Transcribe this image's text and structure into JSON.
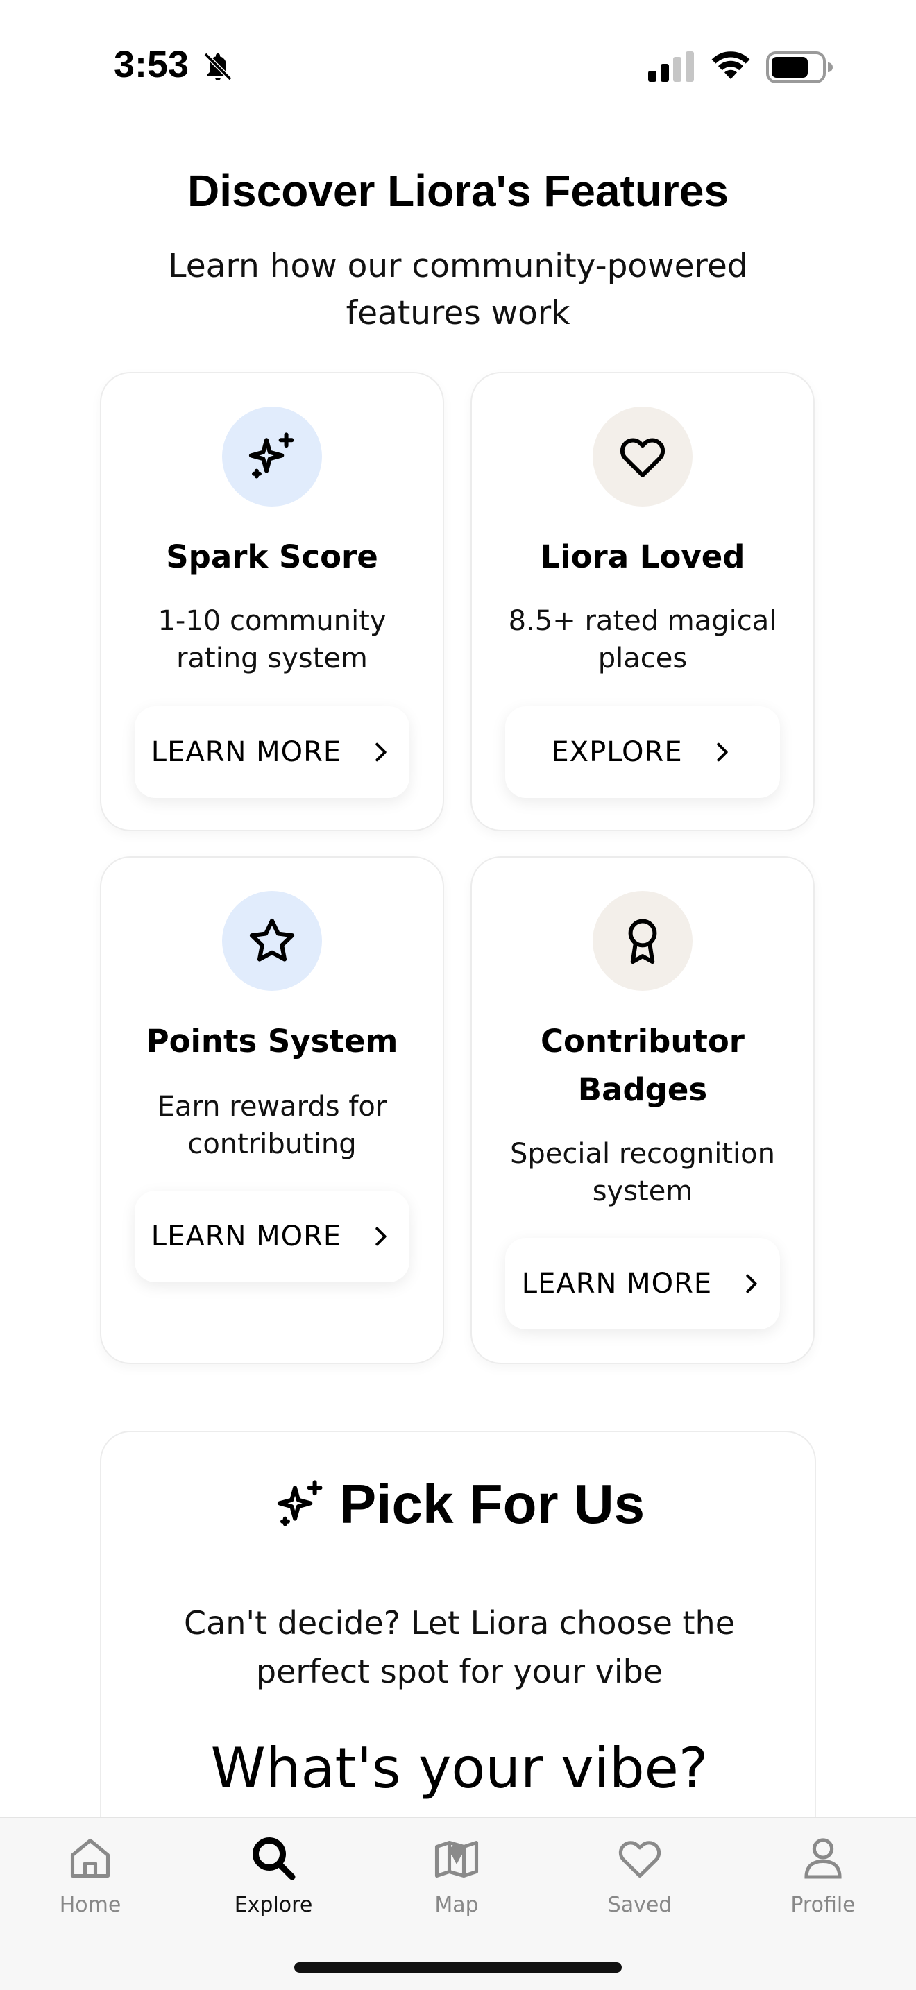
{
  "status_bar": {
    "time": "3:53",
    "icons": [
      "bell-slash-icon",
      "cellular-signal-icon",
      "wifi-icon",
      "battery-icon"
    ]
  },
  "header": {
    "title": "Discover Liora's Features",
    "subtitle": "Learn how our community-powered features work"
  },
  "features": [
    {
      "icon": "sparkles-icon",
      "title": "Spark Score",
      "description": "1-10 community rating system",
      "button": "LEARN MORE",
      "icon_bg": "#e1ecfc"
    },
    {
      "icon": "heart-icon",
      "title": "Liora Loved",
      "description": "8.5+ rated magical places",
      "button": "EXPLORE",
      "icon_bg": "#f3efea"
    },
    {
      "icon": "star-icon",
      "title": "Points System",
      "description": "Earn rewards for contributing",
      "button": "LEARN MORE",
      "icon_bg": "#e1ecfc"
    },
    {
      "icon": "award-icon",
      "title": "Contributor Badges",
      "description": "Special recognition system",
      "button": "LEARN MORE",
      "icon_bg": "#f3efea"
    }
  ],
  "pick_for_us": {
    "icon": "sparkles-icon",
    "title": "Pick For Us",
    "description": "Can't decide? Let Liora choose the perfect spot for your vibe",
    "question": "What's your vibe?"
  },
  "tab_bar": {
    "active": "Explore",
    "tabs": [
      {
        "label": "Home",
        "icon": "home-icon"
      },
      {
        "label": "Explore",
        "icon": "search-icon"
      },
      {
        "label": "Map",
        "icon": "map-icon"
      },
      {
        "label": "Saved",
        "icon": "heart-icon"
      },
      {
        "label": "Profile",
        "icon": "profile-icon"
      }
    ]
  },
  "colors": {
    "blue_icon_bg": "#e1ecfc",
    "beige_icon_bg": "#f3efea",
    "tab_inactive": "#888888",
    "tab_active": "#111111"
  }
}
